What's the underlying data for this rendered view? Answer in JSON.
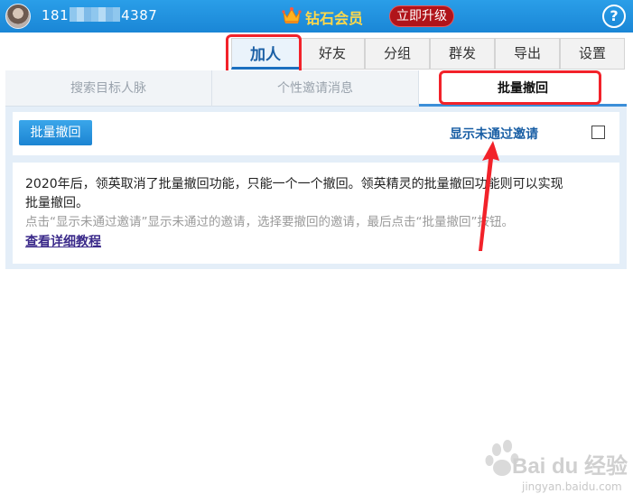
{
  "header": {
    "phone_prefix": "181",
    "phone_suffix": "4387",
    "vip_label": "钻石会员",
    "upgrade_label": "立即升级",
    "help_label": "?"
  },
  "main_tabs": [
    {
      "label": "加人",
      "active": true
    },
    {
      "label": "好友",
      "active": false
    },
    {
      "label": "分组",
      "active": false
    },
    {
      "label": "群发",
      "active": false
    },
    {
      "label": "导出",
      "active": false
    },
    {
      "label": "设置",
      "active": false
    }
  ],
  "sub_tabs": [
    {
      "label": "搜索目标人脉",
      "active": false
    },
    {
      "label": "个性邀请消息",
      "active": false
    },
    {
      "label": "批量撤回",
      "active": true
    }
  ],
  "toolbar": {
    "bulk_withdraw_label": "批量撤回",
    "show_unaccepted_label": "显示未通过邀请",
    "show_unaccepted_checked": false
  },
  "info": {
    "line1": "2020年后，领英取消了批量撤回功能，只能一个一个撤回。领英精灵的批量撤回功能则可以实现",
    "line2": "批量撤回。",
    "hint": "点击“显示未通过邀请”显示未通过的邀请，选择要撤回的邀请，最后点击“批量撤回”按钮。",
    "tutorial_link": "查看详细教程"
  },
  "watermark": {
    "brand": "Bai du 经验",
    "url": "jingyan.baidu.com"
  },
  "colors": {
    "header_blue": "#1a86d6",
    "accent_blue": "#1a5fa5",
    "highlight_red": "#f2222a",
    "upgrade_red": "#b0141a"
  }
}
